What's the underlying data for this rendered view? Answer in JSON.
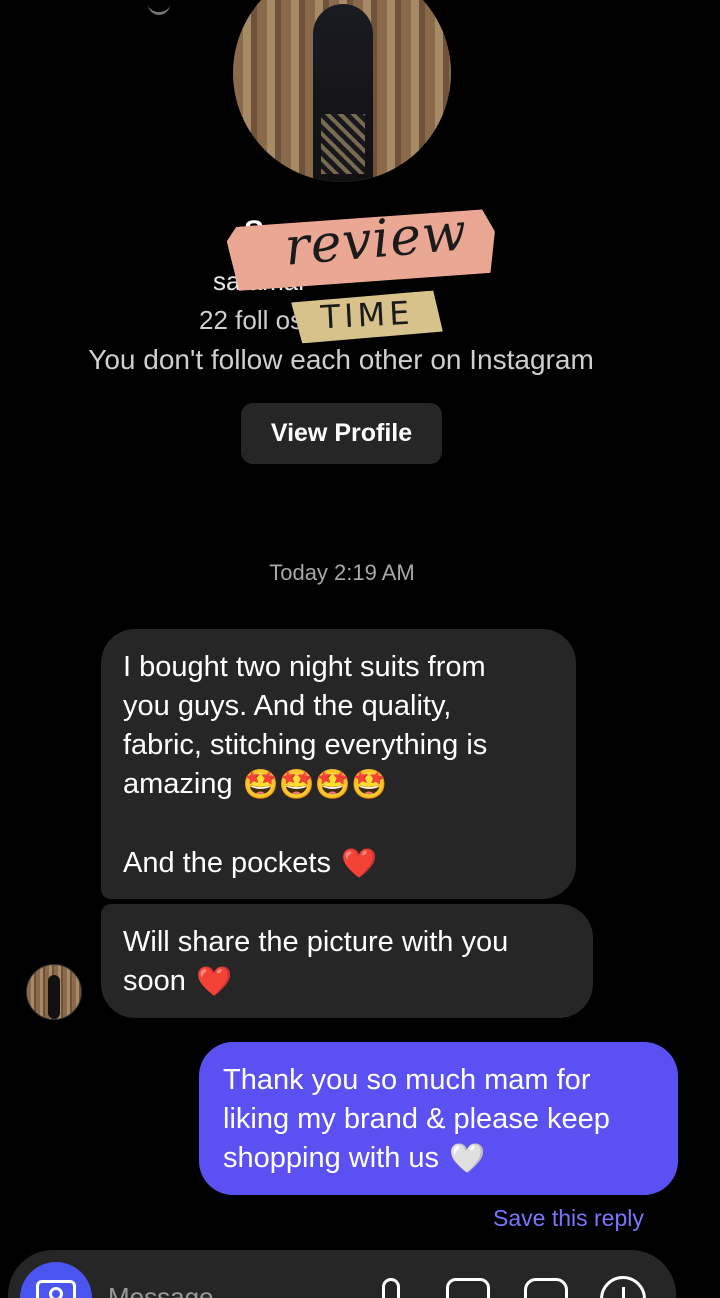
{
  "profile": {
    "name": "Sa",
    "username": "sa                    amai",
    "stats": "22 foll              ost",
    "follow_note": "You don't follow each other on Instagram",
    "view_profile_label": "View Profile"
  },
  "sticker": {
    "word_1": "review",
    "word_2": "TIME"
  },
  "thread": {
    "timestamp": "Today 2:19 AM",
    "incoming": [
      {
        "lines": [
          "I bought two night suits from",
          "you guys. And the quality,",
          "fabric, stitching everything is",
          "amazing"
        ],
        "line_4_emoji": "🤩🤩🤩🤩",
        "line_5": "And the pockets",
        "line_5_emoji": "❤️"
      },
      {
        "lines": [
          "Will share the picture with you",
          "soon"
        ],
        "line_2_emoji": "❤️"
      }
    ],
    "outgoing": {
      "lines": [
        "Thank you so much mam for",
        "liking my brand & please keep",
        "shopping with us"
      ],
      "line_3_emoji": "🤍"
    },
    "save_reply_label": "Save this reply"
  },
  "composer": {
    "placeholder": "Message..."
  },
  "icons": {
    "camera": "camera-icon",
    "mic": "microphone-icon",
    "gallery": "gallery-icon",
    "sticker": "sticker-icon",
    "plus": "plus-circle-icon"
  },
  "colors": {
    "outgoing_bubble": "#5b51f2",
    "incoming_bubble": "#262626",
    "link": "#7a75ff",
    "camera_button": "#4a55f0"
  }
}
